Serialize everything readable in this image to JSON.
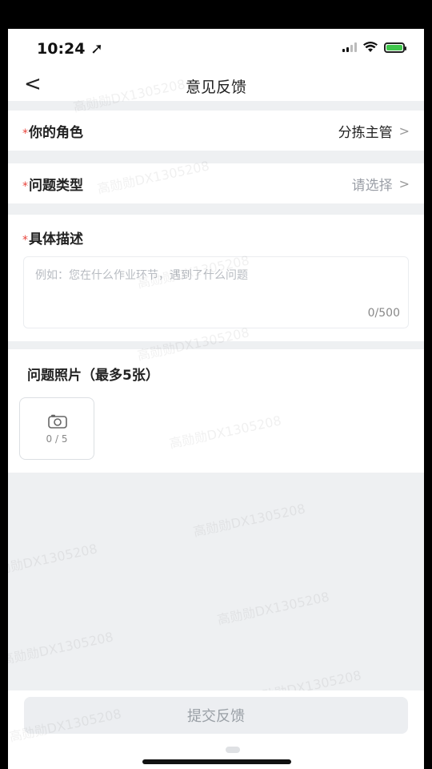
{
  "status_bar": {
    "time": "10:24"
  },
  "nav": {
    "title": "意见反馈"
  },
  "role": {
    "required_mark": "*",
    "label": "你的角色",
    "value": "分拣主管",
    "value_color": "#222222"
  },
  "issue_type": {
    "required_mark": "*",
    "label": "问题类型",
    "placeholder": "请选择",
    "placeholder_color": "#9a9ea6"
  },
  "description": {
    "required_mark": "*",
    "label": "具体描述",
    "placeholder": "例如：您在什么作业环节，遇到了什么问题",
    "counter": "0/500"
  },
  "photos": {
    "label": "问题照片（最多5张）",
    "counter": "0 / 5"
  },
  "submit": {
    "label": "提交反馈"
  },
  "watermark": "高勋勋DX1305208",
  "colors": {
    "required": "#e8453c",
    "background": "#eef0f2",
    "submit_bg": "#eceef1"
  }
}
